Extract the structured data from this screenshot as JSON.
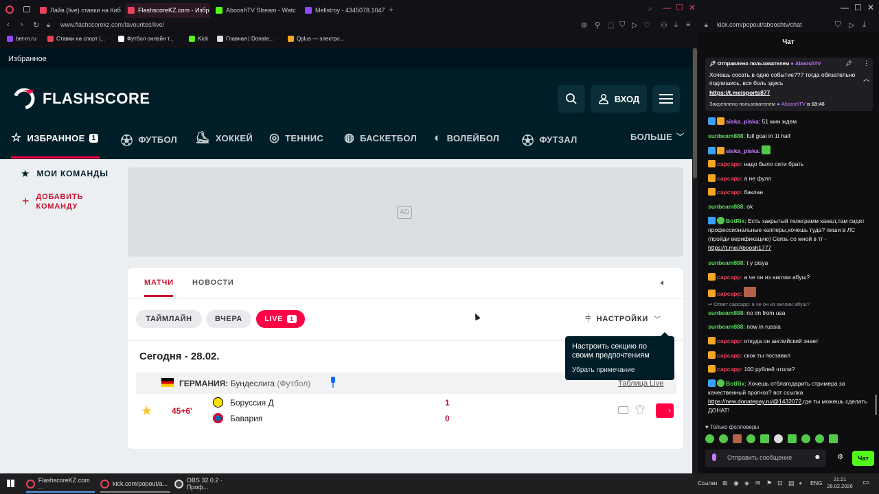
{
  "browser": {
    "tabs": [
      {
        "label": "Лайв (live) ставки на Киб",
        "color": "#e8435a"
      },
      {
        "label": "FlashscoreKZ.com - Избр",
        "color": "#e8435a"
      },
      {
        "label": "AbooshTV Stream - Watc",
        "color": "#53fc18"
      },
      {
        "label": "Mellstroy - 4345078.1047",
        "color": "#9146ff"
      }
    ],
    "new_tab": "+",
    "url_left": "www.flashscorekz.com/favourites/live/",
    "url_right": "kick.com/popout/abooshtv/chat",
    "bookmarks": [
      {
        "label": "bet-m.ru",
        "color": "#9146ff"
      },
      {
        "label": "Ставки на спорт |...",
        "color": "#e8435a"
      },
      {
        "label": "Футбол онлайн т...",
        "color": "#ffffff"
      },
      {
        "label": "Kick",
        "color": "#53fc18"
      },
      {
        "label": "Главная | Donate...",
        "color": "#ffffff"
      },
      {
        "label": "Qplus — электро...",
        "color": "#f5a623"
      }
    ]
  },
  "flashscore": {
    "favbar_title": "Избранное",
    "logo_text": "FLASHSCORE",
    "login_label": "ВХОД",
    "nav": [
      {
        "label": "ИЗБРАННОЕ",
        "icon": "star-icon",
        "badge": "1"
      },
      {
        "label": "ФУТБОЛ",
        "icon": "football-icon"
      },
      {
        "label": "ХОККЕЙ",
        "icon": "hockey-icon"
      },
      {
        "label": "ТЕННИС",
        "icon": "tennis-icon"
      },
      {
        "label": "БАСКЕТБОЛ",
        "icon": "basketball-icon"
      },
      {
        "label": "ВОЛЕЙБОЛ",
        "icon": "volleyball-icon"
      },
      {
        "label": "ФУТЗАЛ",
        "icon": "futsal-icon"
      }
    ],
    "more_label": "БОЛЬШЕ",
    "sidebar": {
      "my_teams": "МОИ КОМАНДЫ",
      "add_team_line1": "ДОБАВИТЬ",
      "add_team_line2": "КОМАНДУ"
    },
    "ad_label": "AD",
    "tabs": {
      "matches": "МАТЧИ",
      "news": "НОВОСТИ"
    },
    "filters": {
      "timeline": "ТАЙМЛАЙН",
      "yesterday": "ВЧЕРА",
      "live": "LIVE",
      "live_count": "1"
    },
    "settings_label": "НАСТРОЙКИ",
    "tooltip": {
      "text": "Настроить секцию по своим предпочтениям",
      "action": "Убрать примечание"
    },
    "date_heading": "Сегодня - 28.02.",
    "league": {
      "country": "ГЕРМАНИЯ:",
      "name": "Бундеслига",
      "sport": "(Футбол)",
      "table_link": "Таблица Live"
    },
    "match": {
      "time": "45+6'",
      "home": "Боруссия Д",
      "away": "Бавария",
      "home_score": "1",
      "away_score": "0"
    },
    "accent": "#ff0046",
    "header_bg": "#001e28"
  },
  "chat": {
    "title": "Чат",
    "pinned": {
      "sent_by_prefix": "Отправлено пользователем",
      "sent_by_user": "AbooshTV",
      "text": "Хочешь сосать в одно событие??? тогда обязательно подпишись, вся боль здесь",
      "link": "https://t.me/sports877",
      "pinned_by_prefix": "Закреплено пользователем",
      "pinned_by_user": "AbooshTV",
      "pinned_time": "в 18:46"
    },
    "messages": [
      {
        "user": "siska_piska",
        "text": "51 мин ждем",
        "color": "p"
      },
      {
        "user": "sunbeam888",
        "text": "full goal in 1t half",
        "color": "g"
      },
      {
        "user": "siska_piska",
        "text": "",
        "color": "p"
      },
      {
        "user": "сарсарр",
        "text": "надо было сити брать",
        "color": "r"
      },
      {
        "user": "сарсарр",
        "text": "а не фулл",
        "color": "r"
      },
      {
        "user": "сарсарр",
        "text": "баклан",
        "color": "r"
      },
      {
        "user": "sunbeam888",
        "text": "ok",
        "color": "g"
      },
      {
        "user": "BotRix",
        "text": "Есть закрытый телеграмм канал,там сидят профессиональные капперы,хочешь туда? пиши в ЛС (пройди верификацию) Связь со мной в тг -",
        "link": "https://t.me/Aboosh1777",
        "color": "g"
      },
      {
        "user": "sunbeam888",
        "text": "t y pisya",
        "color": "g"
      },
      {
        "user": "сарсарр",
        "text": "а че он из англии абуш?",
        "color": "r"
      },
      {
        "user": "сарсарр",
        "text": "",
        "color": "r"
      },
      {
        "user": "sunbeam888",
        "text": "no im from usa",
        "reply": "Ответ сарсарр: а че он из англии абуш?",
        "color": "g"
      },
      {
        "user": "sunbeam888",
        "text": "now in russia",
        "color": "g"
      },
      {
        "user": "сарсарр",
        "text": "откуда он английский знает",
        "color": "r"
      },
      {
        "user": "сарсарр",
        "text": "скок ты поставил",
        "color": "r"
      },
      {
        "user": "сарсарр",
        "text": "100 рублей чтоли?",
        "color": "r"
      },
      {
        "user": "BotRix",
        "text": "Хочешь отблагодарить стримера за качественный прогноз? вот ссылка",
        "link": "https://new.donatepay.ru/@1432072",
        "text2": ",где ты можешь сделать ДОНАТ!",
        "color": "g"
      }
    ],
    "followers_only": "Только фолловеры",
    "input_placeholder": "Отправить сообщение",
    "send_label": "Чат"
  },
  "taskbar": {
    "items": [
      "FlashscoreKZ.com ...",
      "kick.com/popout/a...",
      "OBS 32.0.2 · Проф..."
    ],
    "links_label": "Ссылки",
    "lang": "ENG",
    "time": "21:21",
    "date": "28.02.2026"
  }
}
